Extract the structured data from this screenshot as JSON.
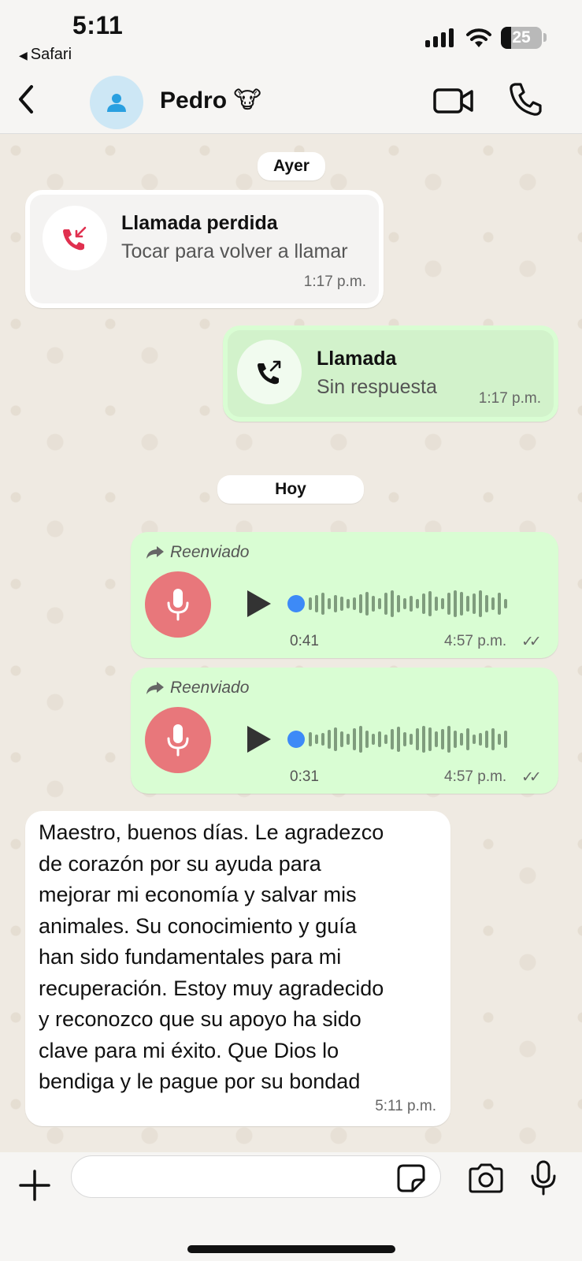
{
  "status_bar": {
    "time": "5:11",
    "back_app": "Safari",
    "battery": "25"
  },
  "header": {
    "contact_name": "Pedro 🐮"
  },
  "chat": {
    "date_yesterday": "Ayer",
    "missed_call": {
      "title": "Llamada perdida",
      "subtitle": "Tocar para volver a llamar",
      "time": "1:17 p.m."
    },
    "outgoing_call": {
      "title": "Llamada",
      "subtitle": "Sin respuesta",
      "time": "1:17 p.m."
    },
    "date_today": "Hoy",
    "voice_messages": [
      {
        "forwarded_label": "Reenviado",
        "duration": "0:41",
        "time": "4:57 p.m.",
        "status": "✓✓"
      },
      {
        "forwarded_label": "Reenviado",
        "duration": "0:31",
        "time": "4:57 p.m.",
        "status": "✓✓"
      }
    ],
    "text_message": {
      "lines": [
        "Maestro, buenos días. Le agradezco",
        "de corazón por su ayuda para",
        "mejorar mi economía y salvar mis",
        "animales. Su conocimiento y guía",
        "han sido fundamentales para mi",
        "recuperación. Estoy muy agradecido",
        "y reconozco que su apoyo ha sido",
        "clave para mi éxito. Que Dios lo",
        "bendiga y le pague por su bondad"
      ],
      "time": "5:11 p.m."
    }
  },
  "composer": {
    "input_value": ""
  },
  "colors": {
    "outgoing_bubble": "#d9fdd3",
    "incoming_bubble": "#ffffff",
    "chat_background": "#efeae2",
    "voice_mic": "#e8777b",
    "missed_call_red": "#e0304f",
    "progress_knob": "#3d8af7"
  },
  "icons": [
    "back-chevron-icon",
    "person-icon",
    "video-camera-icon",
    "phone-icon",
    "missed-call-icon",
    "outgoing-call-icon",
    "forward-arrow-icon",
    "microphone-icon",
    "play-icon",
    "plus-icon",
    "sticker-icon",
    "camera-icon"
  ]
}
